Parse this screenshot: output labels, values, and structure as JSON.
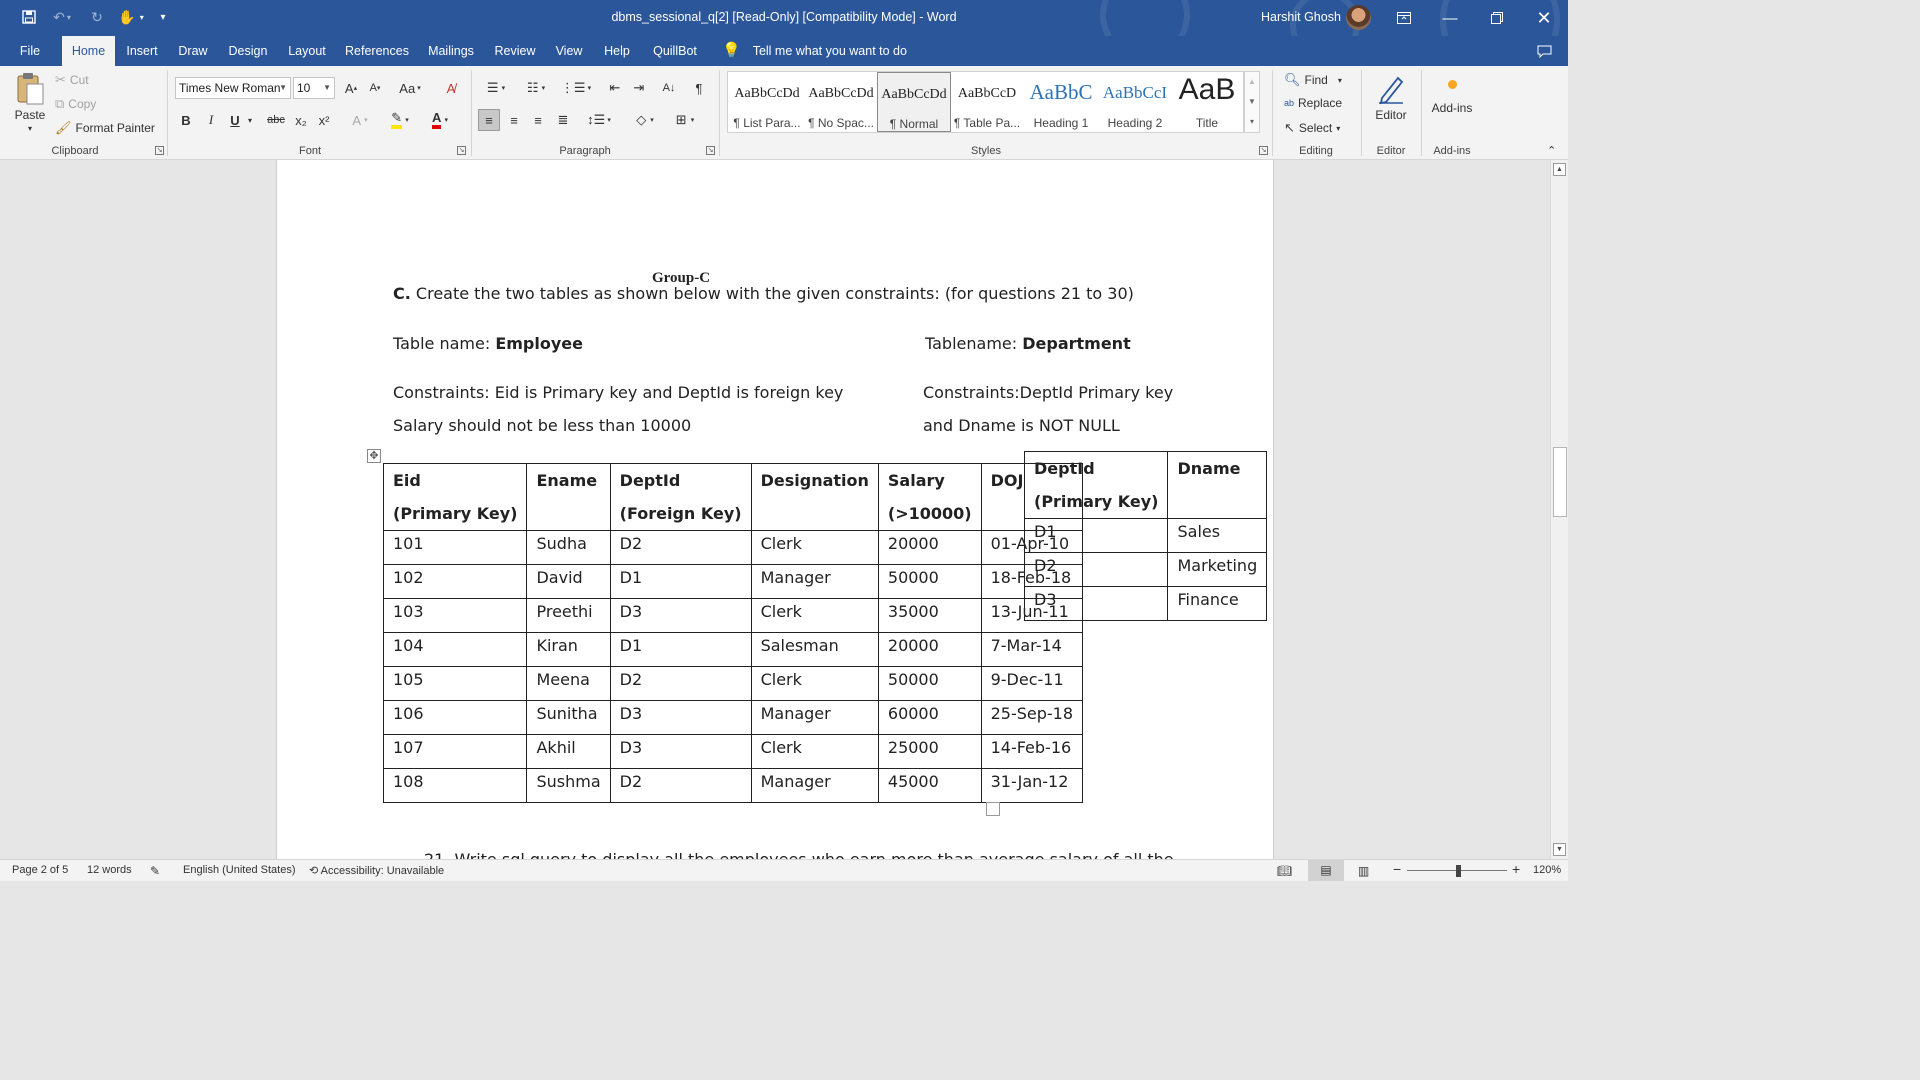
{
  "titlebar": {
    "title": "dbms_sessional_q[2] [Read-Only] [Compatibility Mode]  -  Word",
    "user": "Harshit Ghosh"
  },
  "tabs": [
    "File",
    "Home",
    "Insert",
    "Draw",
    "Design",
    "Layout",
    "References",
    "Mailings",
    "Review",
    "View",
    "Help",
    "QuillBot"
  ],
  "active_tab": "Home",
  "tell_me": "Tell me what you want to do",
  "ribbon": {
    "clipboard": {
      "label": "Clipboard",
      "paste": "Paste",
      "cut": "Cut",
      "copy": "Copy",
      "format_painter": "Format Painter"
    },
    "font": {
      "label": "Font",
      "font_name": "Times New Roman",
      "font_size": "10",
      "bold": "B",
      "italic": "I",
      "underline": "U",
      "strike": "abc",
      "subscript": "x₂",
      "superscript": "x²"
    },
    "paragraph": {
      "label": "Paragraph"
    },
    "styles": {
      "label": "Styles",
      "items": [
        {
          "sample": "AaBbCcDd",
          "name": "¶ List Para..."
        },
        {
          "sample": "AaBbCcDd",
          "name": "¶ No Spac..."
        },
        {
          "sample": "AaBbCcDd",
          "name": "¶ Normal"
        },
        {
          "sample": "AaBbCcD",
          "name": "¶ Table Pa..."
        },
        {
          "sample": "AaBbC",
          "name": "Heading 1"
        },
        {
          "sample": "AaBbCcI",
          "name": "Heading 2"
        },
        {
          "sample": "AaB",
          "name": "Title"
        }
      ],
      "selected": "¶ Normal"
    },
    "editing": {
      "label": "Editing",
      "find": "Find",
      "replace": "Replace",
      "select": "Select"
    },
    "editor": {
      "label": "Editor",
      "button": "Editor"
    },
    "addins": {
      "label": "Add-ins",
      "button": "Add-ins"
    }
  },
  "document": {
    "group_heading": "Group-C",
    "question_prefix": "C.",
    "question_text": "Create the two tables as shown below with the given constraints: (for questions 21 to 30)",
    "employee_label": "Table name: ",
    "employee_name": "Employee",
    "department_label": "Tablename: ",
    "department_name": "Department",
    "emp_constraint_1": "Constraints: Eid is Primary key and DeptId is foreign key",
    "emp_constraint_2": "Salary should not be less than 10000",
    "dept_constraint_1": "Constraints:DeptId Primary key",
    "dept_constraint_2": "and Dname is NOT NULL",
    "employee_table": {
      "headers": [
        [
          "Eid",
          "(Primary Key)"
        ],
        [
          "Ename",
          ""
        ],
        [
          "DeptId",
          "(Foreign Key)"
        ],
        [
          "Designation",
          ""
        ],
        [
          "Salary",
          "(>10000)"
        ],
        [
          "DOJ",
          ""
        ]
      ],
      "rows": [
        [
          "101",
          "Sudha",
          "D2",
          "Clerk",
          "20000",
          "01-Apr-10"
        ],
        [
          "102",
          "David",
          "D1",
          "Manager",
          "50000",
          "18-Feb-18"
        ],
        [
          "103",
          "Preethi",
          "D3",
          "Clerk",
          "35000",
          "13-Jun-11"
        ],
        [
          "104",
          "Kiran",
          "D1",
          "Salesman",
          "20000",
          "7-Mar-14"
        ],
        [
          "105",
          "Meena",
          "D2",
          "Clerk",
          "50000",
          "9-Dec-11"
        ],
        [
          "106",
          "Sunitha",
          "D3",
          "Manager",
          "60000",
          "25-Sep-18"
        ],
        [
          "107",
          "Akhil",
          "D3",
          "Clerk",
          "25000",
          "14-Feb-16"
        ],
        [
          "108",
          "Sushma",
          "D2",
          "Manager",
          "45000",
          "31-Jan-12"
        ]
      ]
    },
    "department_table": {
      "headers": [
        [
          "DeptId",
          "(Primary Key)"
        ],
        [
          "Dname",
          ""
        ]
      ],
      "rows": [
        [
          "D1",
          "Sales"
        ],
        [
          "D2",
          "Marketing"
        ],
        [
          "D3",
          "Finance"
        ]
      ]
    },
    "next_question": "21. Write sql query to display all the employees who earn more than average salary of all the"
  },
  "statusbar": {
    "page": "Page 2 of 5",
    "words": "12 words",
    "language": "English (United States)",
    "accessibility": "Accessibility: Unavailable",
    "zoom": "120%"
  }
}
